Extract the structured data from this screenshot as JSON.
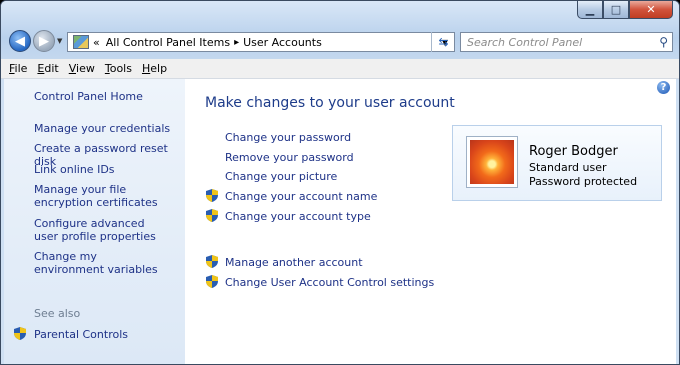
{
  "window": {
    "address_root": "«",
    "breadcrumbs": [
      "All Control Panel Items",
      "User Accounts"
    ],
    "search_placeholder": "Search Control Panel"
  },
  "menu": [
    "File",
    "Edit",
    "View",
    "Tools",
    "Help"
  ],
  "sidebar": {
    "home": "Control Panel Home",
    "links": [
      "Manage your credentials",
      "Create a password reset disk",
      "Link online IDs",
      "Manage your file encryption certificates",
      "Configure advanced user profile properties",
      "Change my environment variables"
    ],
    "see_also_label": "See also",
    "see_also_links": [
      "Parental Controls"
    ]
  },
  "main": {
    "heading": "Make changes to your user account",
    "links": [
      "Change your password",
      "Remove your password",
      "Change your picture",
      "Change your account name",
      "Change your account type"
    ],
    "links2": [
      "Manage another account",
      "Change User Account Control settings"
    ]
  },
  "user": {
    "name": "Roger Bodger",
    "type": "Standard user",
    "status": "Password protected"
  },
  "colors": {
    "link": "#1e3287",
    "heading": "#1e3c8a",
    "sidebar_bg": "#dce8f6"
  }
}
